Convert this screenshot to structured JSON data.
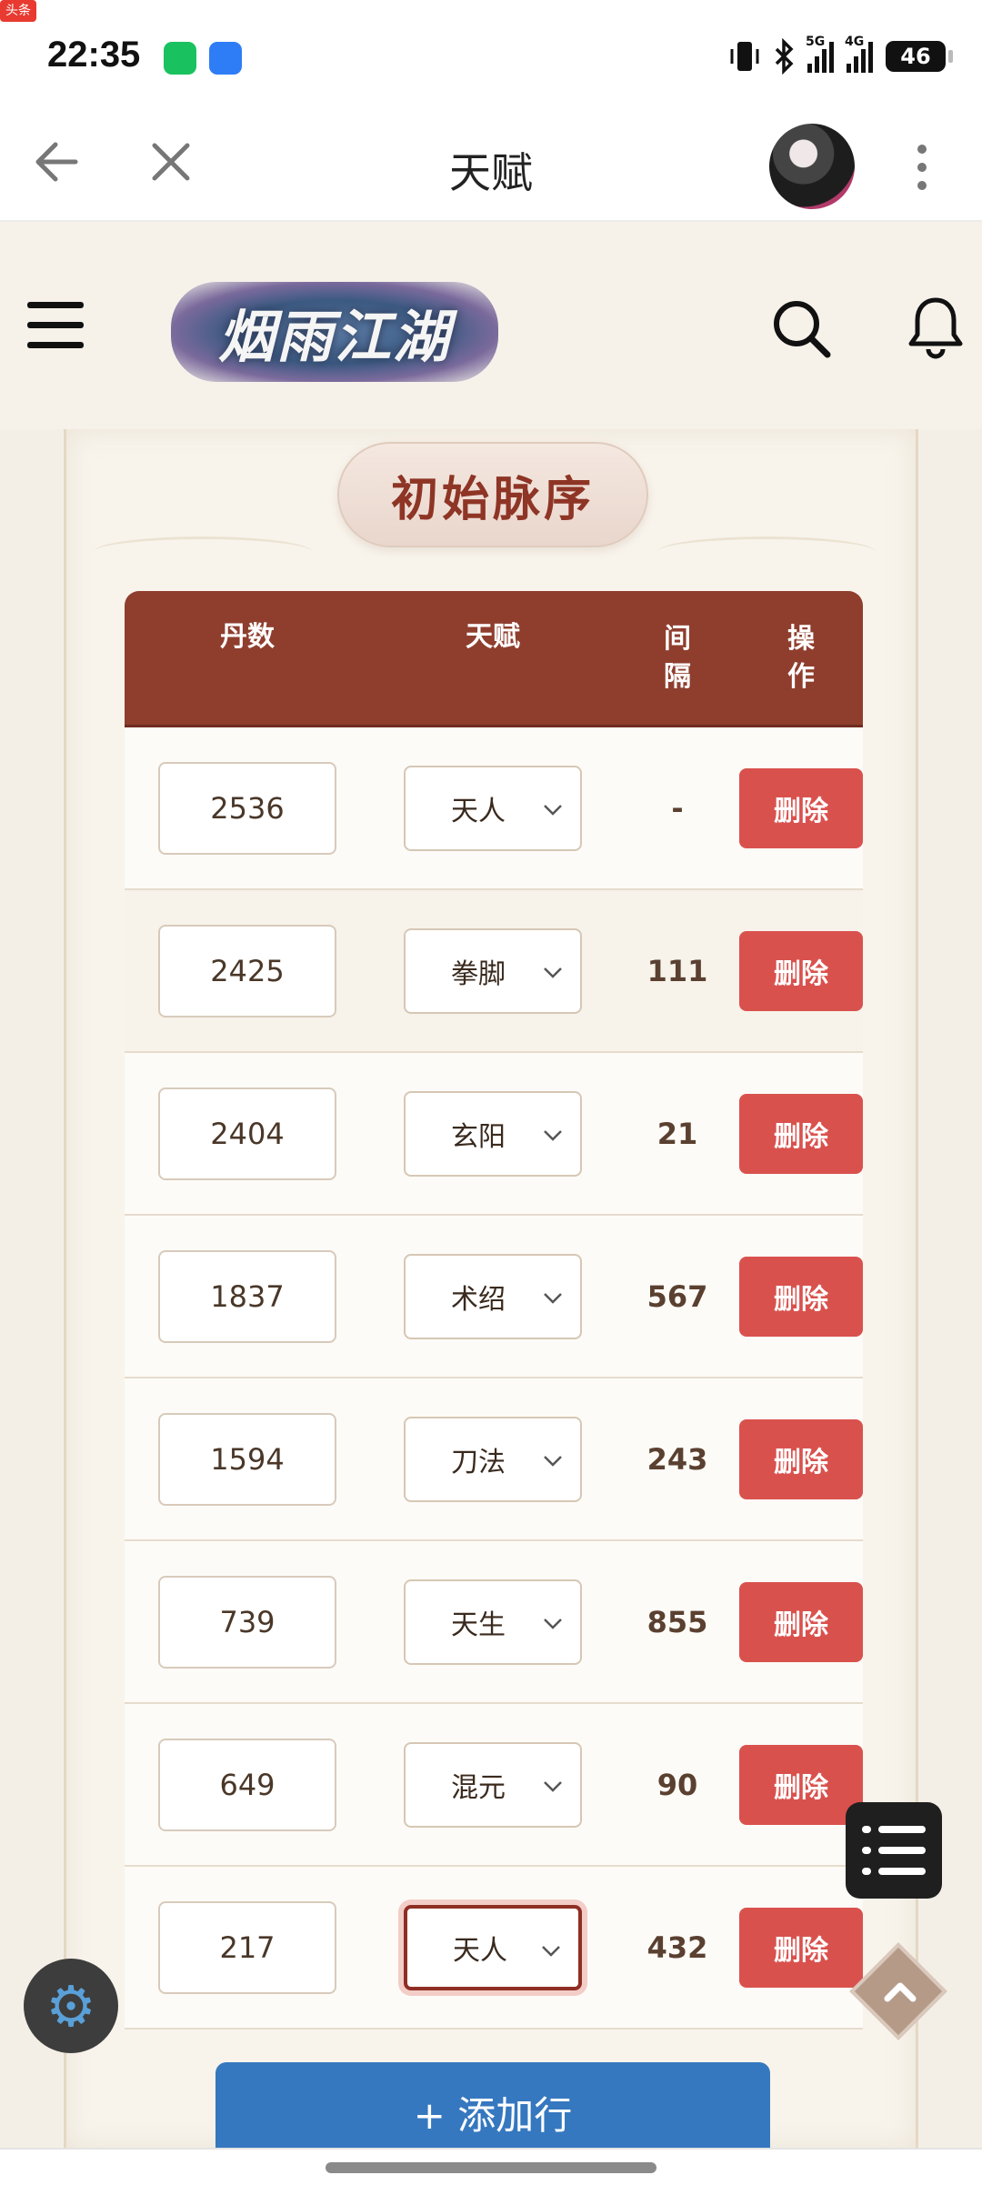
{
  "status_bar": {
    "time": "22:35",
    "news_badge": "头条",
    "net1": "5G",
    "net2": "4G",
    "battery": "46"
  },
  "browser": {
    "title": "天赋"
  },
  "site": {
    "logo_text": "烟雨江湖"
  },
  "section": {
    "title": "初始脉序"
  },
  "table": {
    "headers": {
      "dan": "丹数",
      "talent": "天赋",
      "gap": "间\n隔",
      "op": "操\n作"
    },
    "rows": [
      {
        "dan": "2536",
        "talent": "天人",
        "gap": "-",
        "action": "删除"
      },
      {
        "dan": "2425",
        "talent": "拳脚",
        "gap": "111",
        "action": "删除"
      },
      {
        "dan": "2404",
        "talent": "玄阳",
        "gap": "21",
        "action": "删除"
      },
      {
        "dan": "1837",
        "talent": "术绍",
        "gap": "567",
        "action": "删除"
      },
      {
        "dan": "1594",
        "talent": "刀法",
        "gap": "243",
        "action": "删除"
      },
      {
        "dan": "739",
        "talent": "天生",
        "gap": "855",
        "action": "删除"
      },
      {
        "dan": "649",
        "talent": "混元",
        "gap": "90",
        "action": "删除"
      },
      {
        "dan": "217",
        "talent": "天人",
        "gap": "432",
        "action": "删除"
      }
    ]
  },
  "add_button": "+ 添加行",
  "colors": {
    "header_bg": "#8f3e2e",
    "delete_bg": "#d9514d",
    "add_bg": "#3578bf",
    "title_text": "#8e3526"
  }
}
